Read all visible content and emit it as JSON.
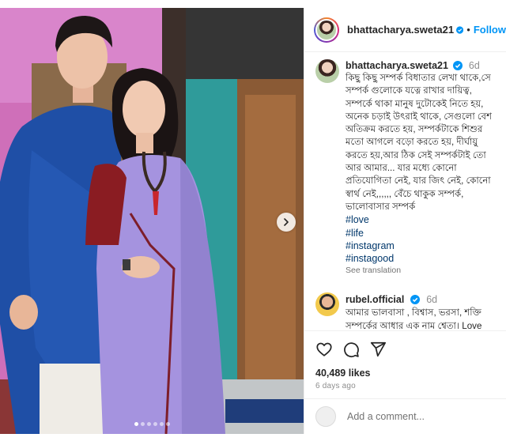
{
  "post": {
    "author": "bhattacharya.sweta21",
    "follow_label": "Follow",
    "separator": "•"
  },
  "caption": {
    "username": "bhattacharya.sweta21",
    "time": "6d",
    "lines": [
      "কিছু কিছু সম্পর্ক বিধাতার লেখা থাকে,সে",
      "সম্পর্ক গুলোকে যত্নে রাখার দায়িত্ব,",
      "সম্পর্কে থাকা মানুষ দুটোকেই নিতে হয়,",
      "অনেক চড়াই উৎরাই থাকে, সেগুলো বেশ",
      "অতিক্রম করতে হয়, সম্পর্কটাকে শিশুর",
      "মতো আগলে বড়ো করতে হয়, দীর্ঘায়ু",
      "করতে হয়,আর ঠিক সেই সম্পর্কটাই তো",
      "আর আমার... যার মধ্যে কোনো",
      "প্রতিযোগিতা নেই, যার জিৎ নেই, কোনো",
      "স্বার্থ নেই,,,,,, বেঁচে থাকুক সম্পর্ক,",
      "ভালোবাসার সম্পর্ক"
    ],
    "hashtags": [
      "#love",
      "#life",
      "#instagram",
      "#instagood"
    ],
    "see_translation": "See translation"
  },
  "comment": {
    "username": "rubel.official",
    "time": "6d",
    "lines": [
      "আমার ভালবাসা , বিশ্বাস, ভরসা, শক্তি",
      "সম্পর্কের আধার এক নাম শ্বেতা। Love"
    ]
  },
  "stats": {
    "likes": "40,489 likes",
    "date": "6 days ago"
  },
  "add_comment": {
    "placeholder": "Add a comment..."
  },
  "carousel": {
    "slide_count": 6,
    "active_index": 0
  },
  "icons": [
    "heart-icon",
    "comment-icon",
    "share-icon",
    "verified-icon",
    "chevron-right-icon",
    "emoji-icon"
  ],
  "colors": {
    "accent": "#0095f6",
    "hashtag": "#00376b",
    "muted": "#8e8e8e"
  }
}
